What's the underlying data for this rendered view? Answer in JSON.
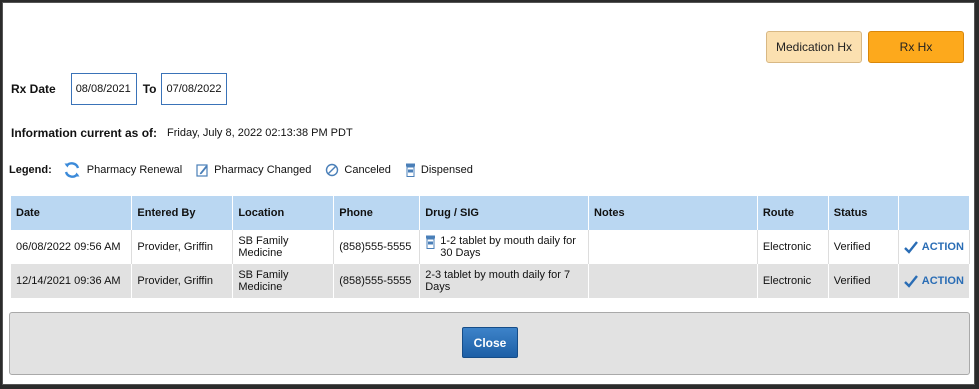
{
  "top_buttons": {
    "medication_hx": "Medication Hx",
    "rx_hx": "Rx Hx"
  },
  "rx_date": {
    "label": "Rx Date",
    "from": "08/08/2021",
    "to_label": "To",
    "to": "07/08/2022"
  },
  "info": {
    "label": "Information current as of:",
    "value": "Friday, July 8, 2022 02:13:38 PM PDT"
  },
  "legend": {
    "label": "Legend:",
    "items": [
      {
        "label": "Pharmacy Renewal",
        "icon": "renewal-icon"
      },
      {
        "label": "Pharmacy Changed",
        "icon": "edit-icon"
      },
      {
        "label": "Canceled",
        "icon": "cancel-icon"
      },
      {
        "label": "Dispensed",
        "icon": "bottle-icon"
      }
    ]
  },
  "table": {
    "headers": [
      "Date",
      "Entered By",
      "Location",
      "Phone",
      "Drug / SIG",
      "Notes",
      "Route",
      "Status",
      ""
    ],
    "rows": [
      {
        "date": "06/08/2022 09:56 AM",
        "entered_by": "Provider, Griffin",
        "location": "SB Family Medicine",
        "phone": "(858)555-5555",
        "drug": "1-2 tablet by mouth daily for 30 Days",
        "notes": "",
        "route": "Electronic",
        "status": "Verified",
        "action": "ACTION"
      },
      {
        "date": "12/14/2021 09:36 AM",
        "entered_by": "Provider, Griffin",
        "location": "SB Family Medicine",
        "phone": "(858)555-5555",
        "drug": "2-3 tablet by mouth daily for 7 Days",
        "notes": "",
        "route": "Electronic",
        "status": "Verified",
        "action": "ACTION"
      }
    ]
  },
  "footer": {
    "close": "Close"
  },
  "colors": {
    "header_bg": "#bad7f2",
    "accent_orange": "#fda91c",
    "action_blue": "#2a6db5",
    "close_blue": "#1d5fa6"
  }
}
